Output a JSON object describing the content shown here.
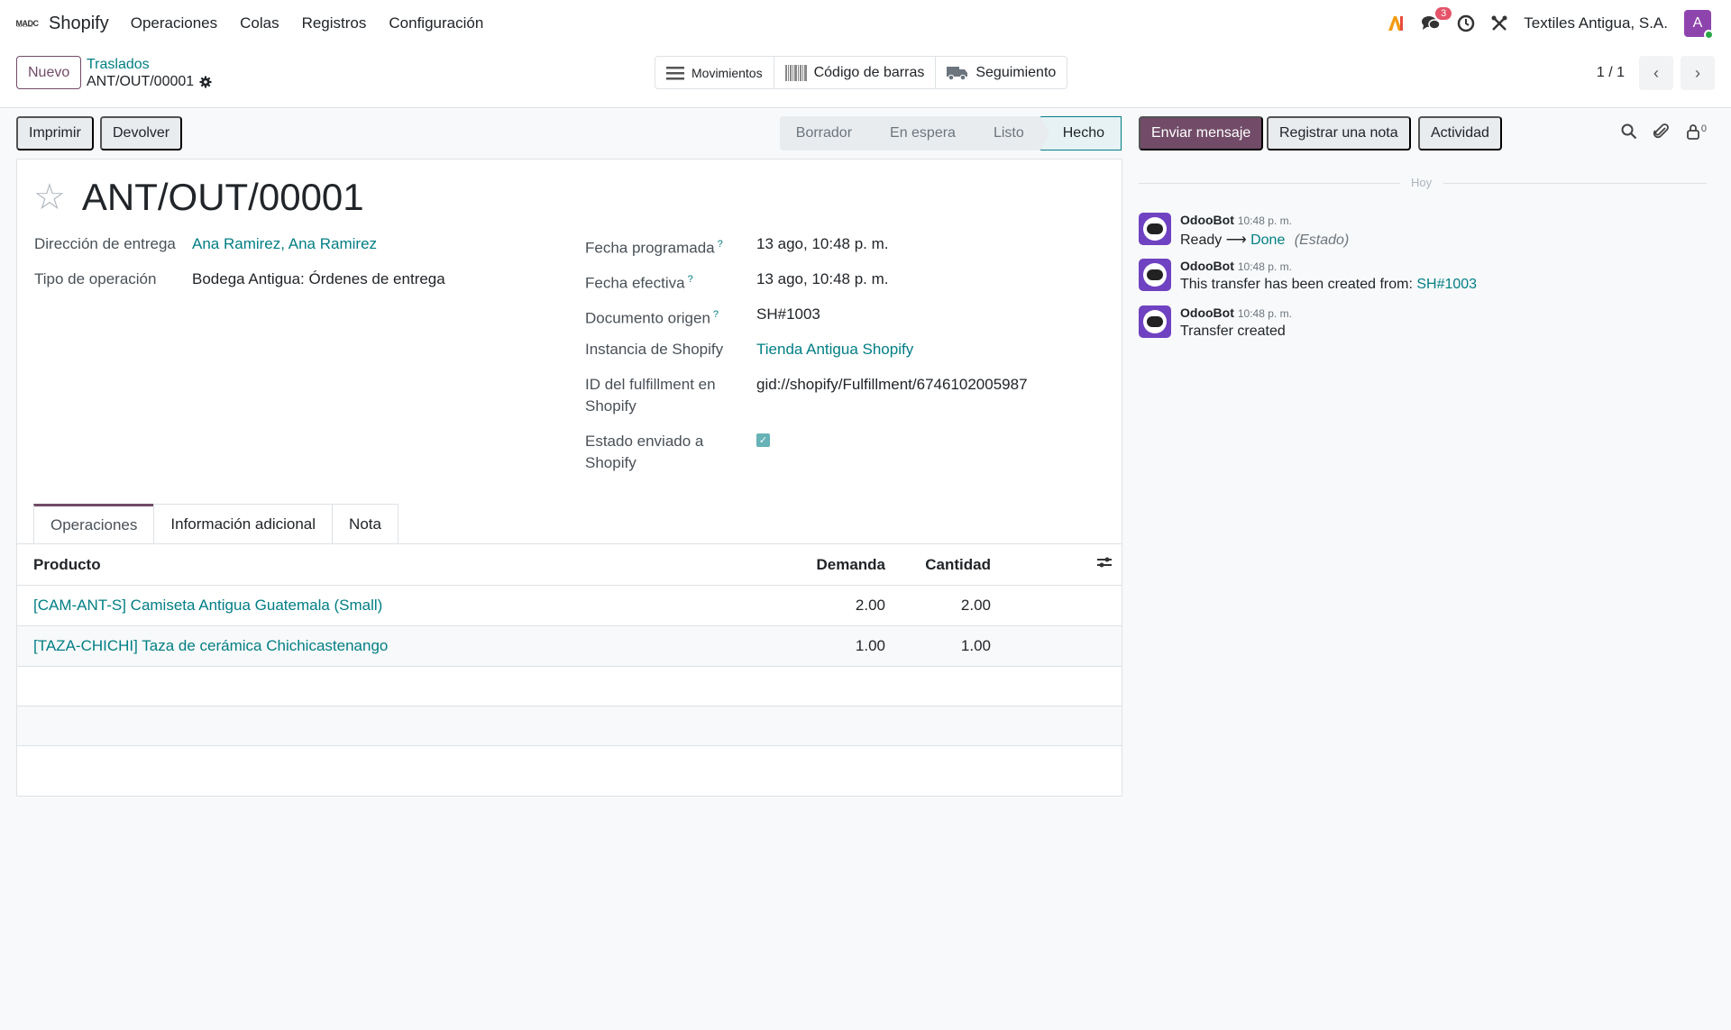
{
  "topbar": {
    "app_name": "Shopify",
    "logo_text": "M̲A̲D̲C",
    "menu": [
      "Operaciones",
      "Colas",
      "Registros",
      "Configuración"
    ],
    "messages_badge": "3",
    "company": "Textiles Antigua, S.A.",
    "avatar_letter": "A"
  },
  "control": {
    "new_label": "Nuevo",
    "breadcrumb_parent": "Traslados",
    "breadcrumb_current": "ANT/OUT/00001",
    "smart_buttons": [
      "Movimientos",
      "Código de barras",
      "Seguimiento"
    ],
    "pager": "1 / 1"
  },
  "statusbar": {
    "print_label": "Imprimir",
    "return_label": "Devolver",
    "stages": [
      "Borrador",
      "En espera",
      "Listo",
      "Hecho"
    ],
    "active_stage": "Hecho"
  },
  "form": {
    "title": "ANT/OUT/00001",
    "left_fields": [
      {
        "label": "Dirección de entrega",
        "value": "Ana Ramirez, Ana Ramirez"
      },
      {
        "label": "Tipo de operación",
        "value": "Bodega Antigua: Órdenes de entrega"
      }
    ],
    "right_fields": {
      "scheduled_label": "Fecha programada",
      "scheduled_value": "13 ago, 10:48 p. m.",
      "effective_label": "Fecha efectiva",
      "effective_value": "13 ago, 10:48 p. m.",
      "origin_label": "Documento origen",
      "origin_value": "SH#1003",
      "instance_label": "Instancia de Shopify",
      "instance_value": "Tienda Antigua Shopify",
      "fulfillment_label_1": "ID del fulfillment en",
      "fulfillment_label_2": "Shopify",
      "fulfillment_value": "gid://shopify/Fulfillment/6746102005987",
      "sent_label_1": "Estado enviado a",
      "sent_label_2": "Shopify",
      "help_mark": "?"
    },
    "tabs": [
      "Operaciones",
      "Información adicional",
      "Nota"
    ],
    "table": {
      "headers": {
        "product": "Producto",
        "demand": "Demanda",
        "quantity": "Cantidad"
      },
      "rows": [
        {
          "product": "[CAM-ANT-S] Camiseta Antigua Guatemala (Small)",
          "demand": "2.00",
          "quantity": "2.00"
        },
        {
          "product": "[TAZA-CHICHI] Taza de cerámica Chichicastenango",
          "demand": "1.00",
          "quantity": "1.00"
        }
      ]
    }
  },
  "chatter": {
    "send_label": "Enviar mensaje",
    "note_label": "Registrar una nota",
    "activity_label": "Actividad",
    "followers_count": "0",
    "day_label": "Hoy",
    "messages": [
      {
        "author": "OdooBot",
        "time": "10:48 p. m.",
        "from": "Ready",
        "to": "Done",
        "field": "(Estado)"
      },
      {
        "author": "OdooBot",
        "time": "10:48 p. m.",
        "text": "This transfer has been created from: ",
        "link": "SH#1003"
      },
      {
        "author": "OdooBot",
        "time": "10:48 p. m.",
        "text": "Transfer created"
      }
    ]
  }
}
